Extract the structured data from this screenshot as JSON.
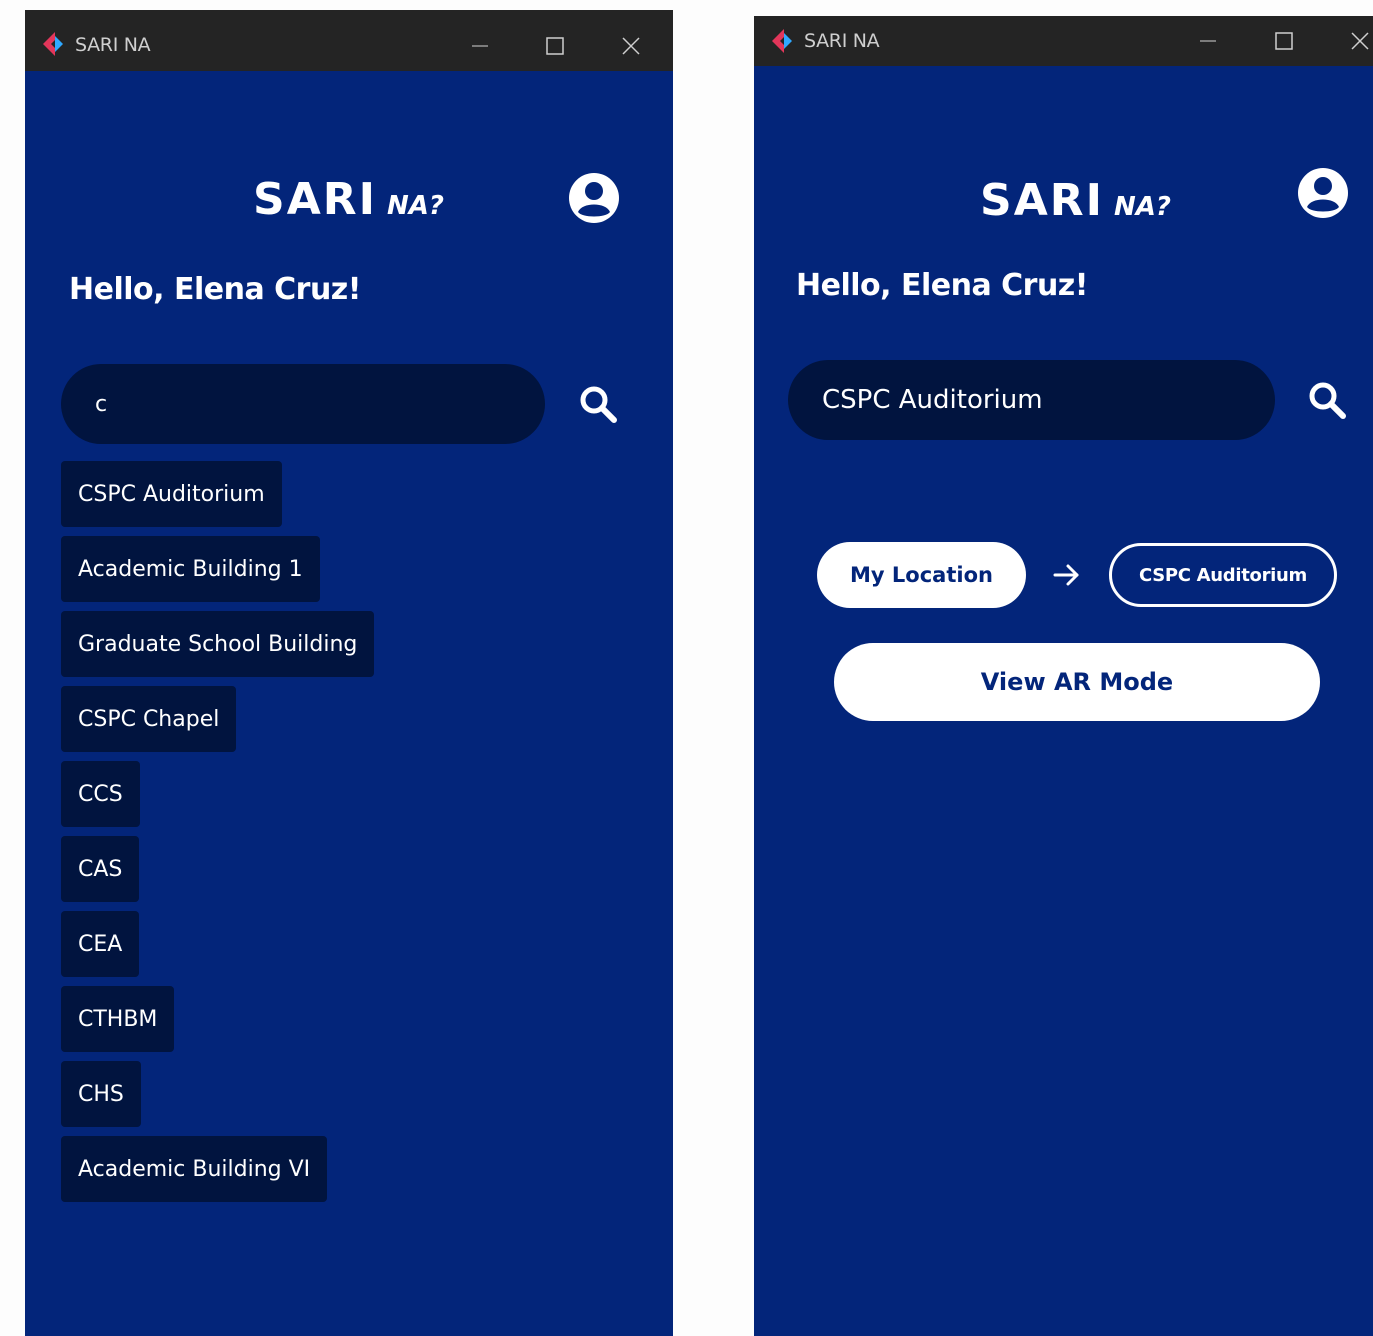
{
  "app": {
    "title": "SARI NA",
    "logo_main": "SARI",
    "logo_sub": "NA?"
  },
  "colors": {
    "background": "#03257a",
    "field": "#01143f",
    "titlebar": "#242424",
    "accent_left": "#e2365a",
    "accent_right": "#2fa8ff"
  },
  "left": {
    "greeting": "Hello, Elena Cruz!",
    "search_value": "c",
    "suggestions": [
      "CSPC Auditorium",
      "Academic Building 1",
      "Graduate School Building",
      "CSPC Chapel",
      "CCS",
      "CAS",
      "CEA",
      "CTHBM",
      "CHS",
      "Academic Building VI"
    ]
  },
  "right": {
    "greeting": "Hello, Elena Cruz!",
    "search_value": "CSPC Auditorium",
    "route_from": "My Location",
    "route_to": "CSPC Auditorium",
    "ar_button": "View AR Mode"
  },
  "icons": {
    "app": "app-logo-icon",
    "minimize": "minimize-icon",
    "maximize": "maximize-icon",
    "close": "close-icon",
    "profile": "user-circle-icon",
    "search": "search-icon",
    "arrow": "arrow-right-icon"
  }
}
